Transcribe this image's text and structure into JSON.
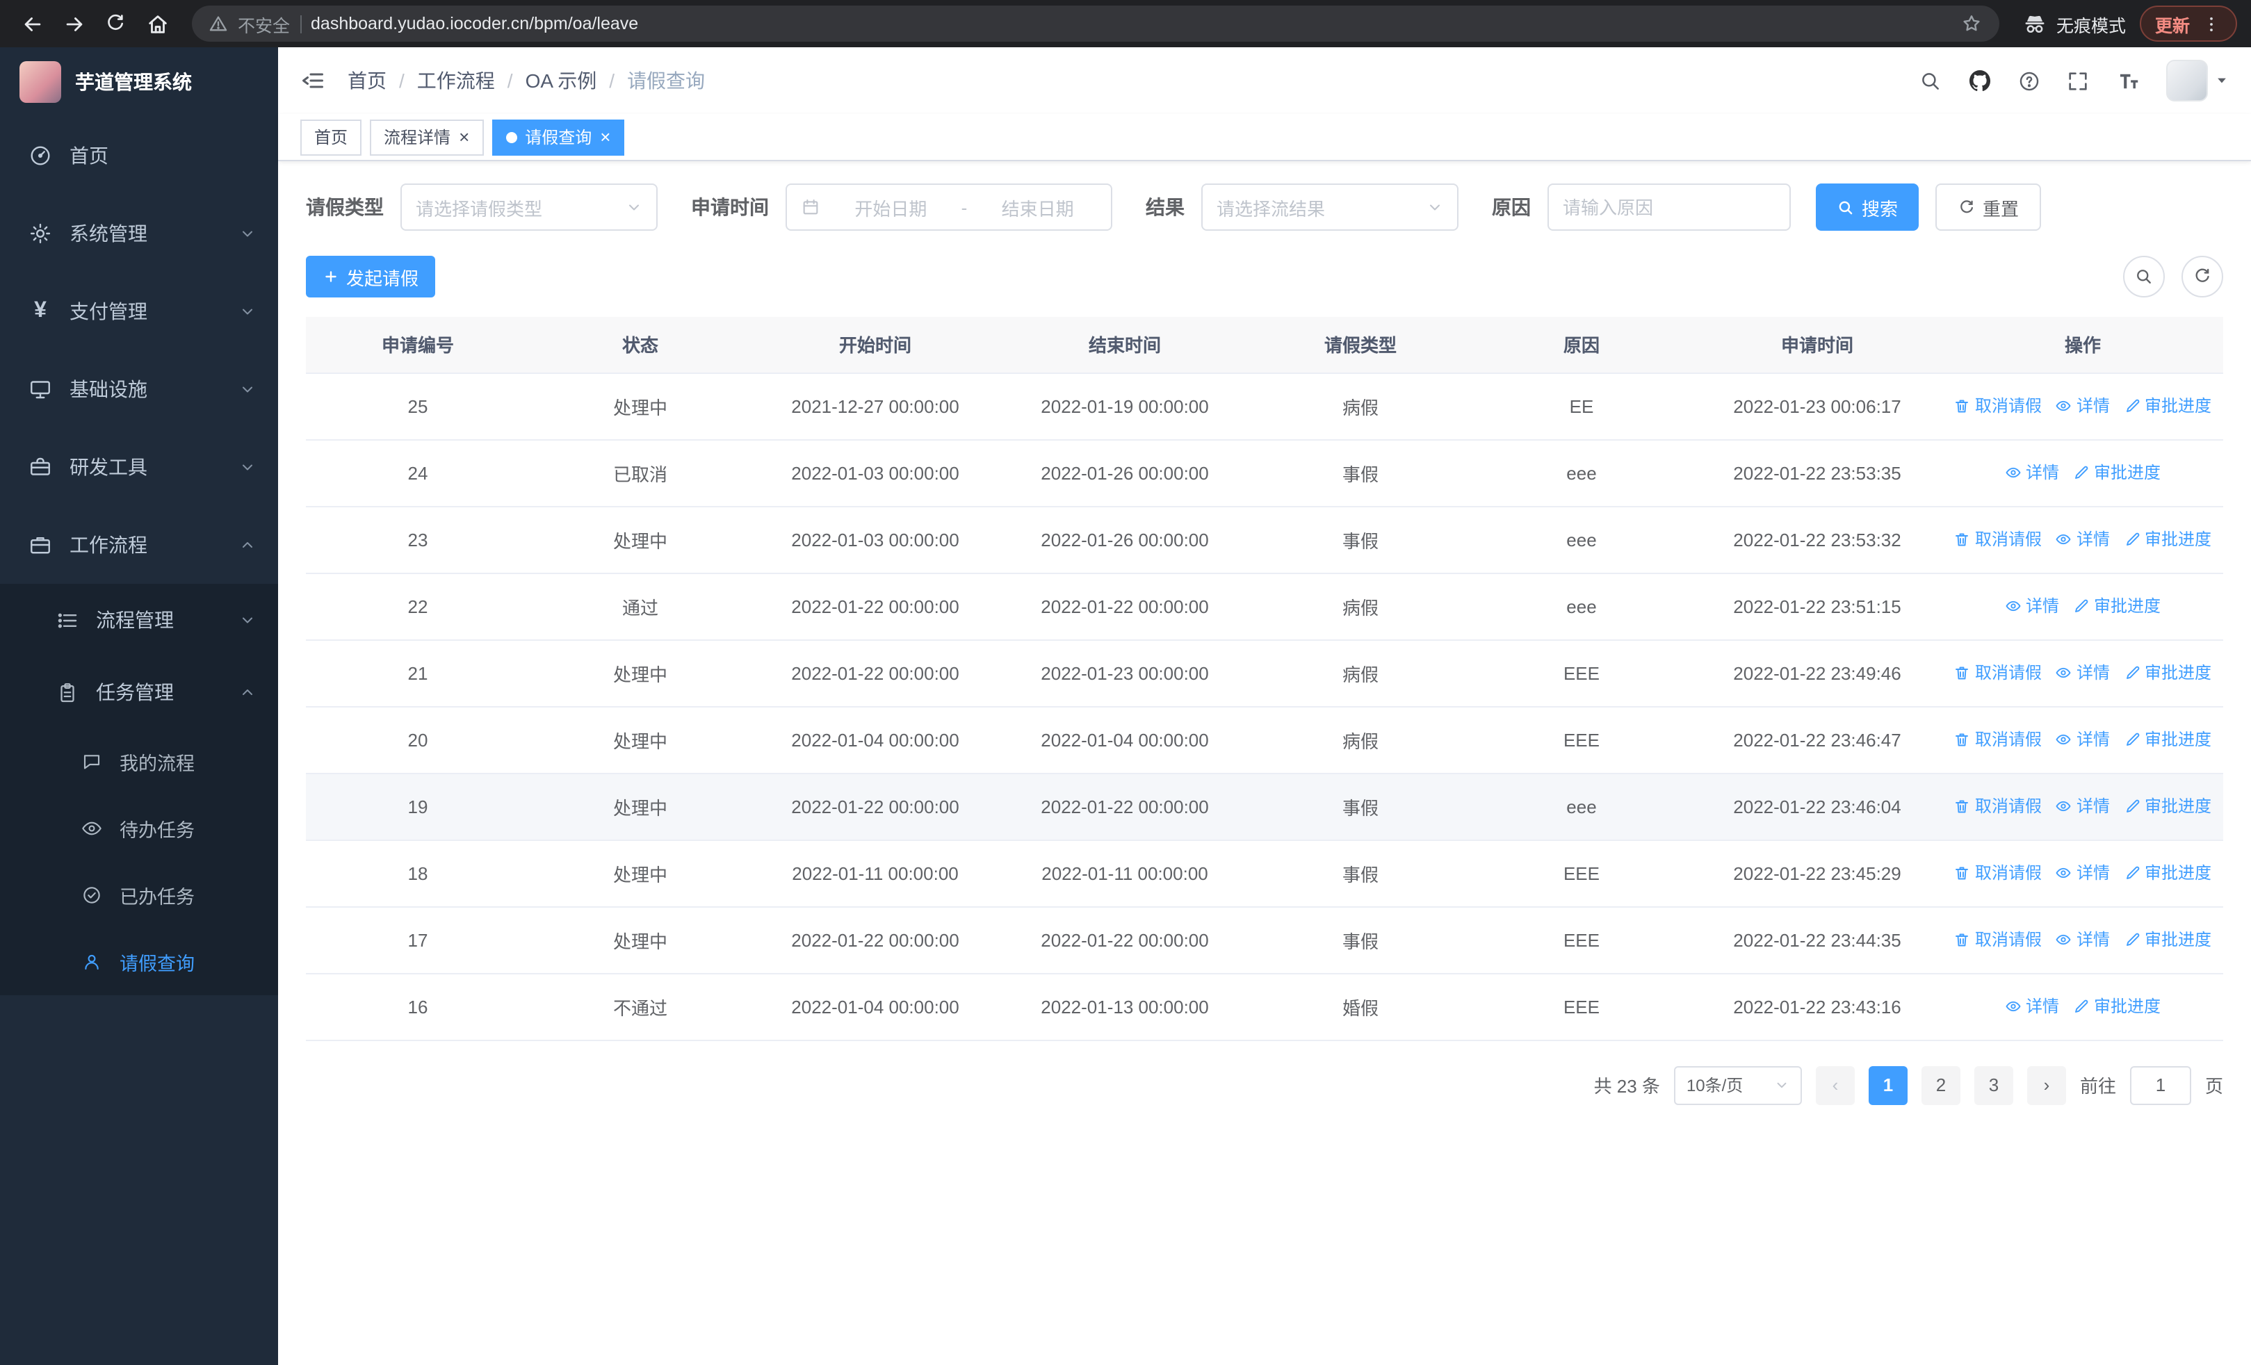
{
  "browser": {
    "security_label": "不安全",
    "url": "dashboard.yudao.iocoder.cn/bpm/oa/leave",
    "incognito_label": "无痕模式",
    "update_label": "更新"
  },
  "app": {
    "title": "芋道管理系统"
  },
  "sidebar": {
    "items": [
      {
        "label": "首页"
      },
      {
        "label": "系统管理"
      },
      {
        "label": "支付管理"
      },
      {
        "label": "基础设施"
      },
      {
        "label": "研发工具"
      },
      {
        "label": "工作流程"
      }
    ],
    "workflow_children": [
      {
        "label": "流程管理"
      },
      {
        "label": "任务管理"
      }
    ],
    "task_children": [
      {
        "label": "我的流程"
      },
      {
        "label": "待办任务"
      },
      {
        "label": "已办任务"
      },
      {
        "label": "请假查询"
      }
    ]
  },
  "breadcrumb": {
    "separator": "/",
    "items": [
      "首页",
      "工作流程",
      "OA 示例",
      "请假查询"
    ]
  },
  "tabs": [
    {
      "label": "首页"
    },
    {
      "label": "流程详情"
    },
    {
      "label": "请假查询"
    }
  ],
  "icons": {
    "yen": "¥",
    "close": "×"
  },
  "filters": {
    "leave_type_label": "请假类型",
    "leave_type_placeholder": "请选择请假类型",
    "apply_time_label": "申请时间",
    "date_start_placeholder": "开始日期",
    "date_separator": "-",
    "date_end_placeholder": "结束日期",
    "result_label": "结果",
    "result_placeholder": "请选择流结果",
    "reason_label": "原因",
    "reason_placeholder": "请输入原因",
    "search_button": "搜索",
    "reset_button": "重置"
  },
  "toolbar": {
    "create_label": "发起请假"
  },
  "table": {
    "columns": [
      "申请编号",
      "状态",
      "开始时间",
      "结束时间",
      "请假类型",
      "原因",
      "申请时间",
      "操作"
    ],
    "actions": {
      "cancel": "取消请假",
      "detail": "详情",
      "progress": "审批进度"
    },
    "rows": [
      {
        "id": "25",
        "status": "处理中",
        "start": "2021-12-27 00:00:00",
        "end": "2022-01-19 00:00:00",
        "type": "病假",
        "reason": "EE",
        "applied": "2022-01-23 00:06:17",
        "cancellable": true
      },
      {
        "id": "24",
        "status": "已取消",
        "start": "2022-01-03 00:00:00",
        "end": "2022-01-26 00:00:00",
        "type": "事假",
        "reason": "eee",
        "applied": "2022-01-22 23:53:35",
        "cancellable": false
      },
      {
        "id": "23",
        "status": "处理中",
        "start": "2022-01-03 00:00:00",
        "end": "2022-01-26 00:00:00",
        "type": "事假",
        "reason": "eee",
        "applied": "2022-01-22 23:53:32",
        "cancellable": true
      },
      {
        "id": "22",
        "status": "通过",
        "start": "2022-01-22 00:00:00",
        "end": "2022-01-22 00:00:00",
        "type": "病假",
        "reason": "eee",
        "applied": "2022-01-22 23:51:15",
        "cancellable": false
      },
      {
        "id": "21",
        "status": "处理中",
        "start": "2022-01-22 00:00:00",
        "end": "2022-01-23 00:00:00",
        "type": "病假",
        "reason": "EEE",
        "applied": "2022-01-22 23:49:46",
        "cancellable": true
      },
      {
        "id": "20",
        "status": "处理中",
        "start": "2022-01-04 00:00:00",
        "end": "2022-01-04 00:00:00",
        "type": "病假",
        "reason": "EEE",
        "applied": "2022-01-22 23:46:47",
        "cancellable": true
      },
      {
        "id": "19",
        "status": "处理中",
        "start": "2022-01-22 00:00:00",
        "end": "2022-01-22 00:00:00",
        "type": "事假",
        "reason": "eee",
        "applied": "2022-01-22 23:46:04",
        "cancellable": true,
        "highlighted": true
      },
      {
        "id": "18",
        "status": "处理中",
        "start": "2022-01-11 00:00:00",
        "end": "2022-01-11 00:00:00",
        "type": "事假",
        "reason": "EEE",
        "applied": "2022-01-22 23:45:29",
        "cancellable": true
      },
      {
        "id": "17",
        "status": "处理中",
        "start": "2022-01-22 00:00:00",
        "end": "2022-01-22 00:00:00",
        "type": "事假",
        "reason": "EEE",
        "applied": "2022-01-22 23:44:35",
        "cancellable": true
      },
      {
        "id": "16",
        "status": "不通过",
        "start": "2022-01-04 00:00:00",
        "end": "2022-01-13 00:00:00",
        "type": "婚假",
        "reason": "EEE",
        "applied": "2022-01-22 23:43:16",
        "cancellable": false
      }
    ]
  },
  "pagination": {
    "total": "共 23 条",
    "page_size": "10条/页",
    "prev": "‹",
    "next": "›",
    "pages": [
      "1",
      "2",
      "3"
    ],
    "active_page": "1",
    "goto_label": "前往",
    "goto_value": "1",
    "page_unit": "页"
  }
}
